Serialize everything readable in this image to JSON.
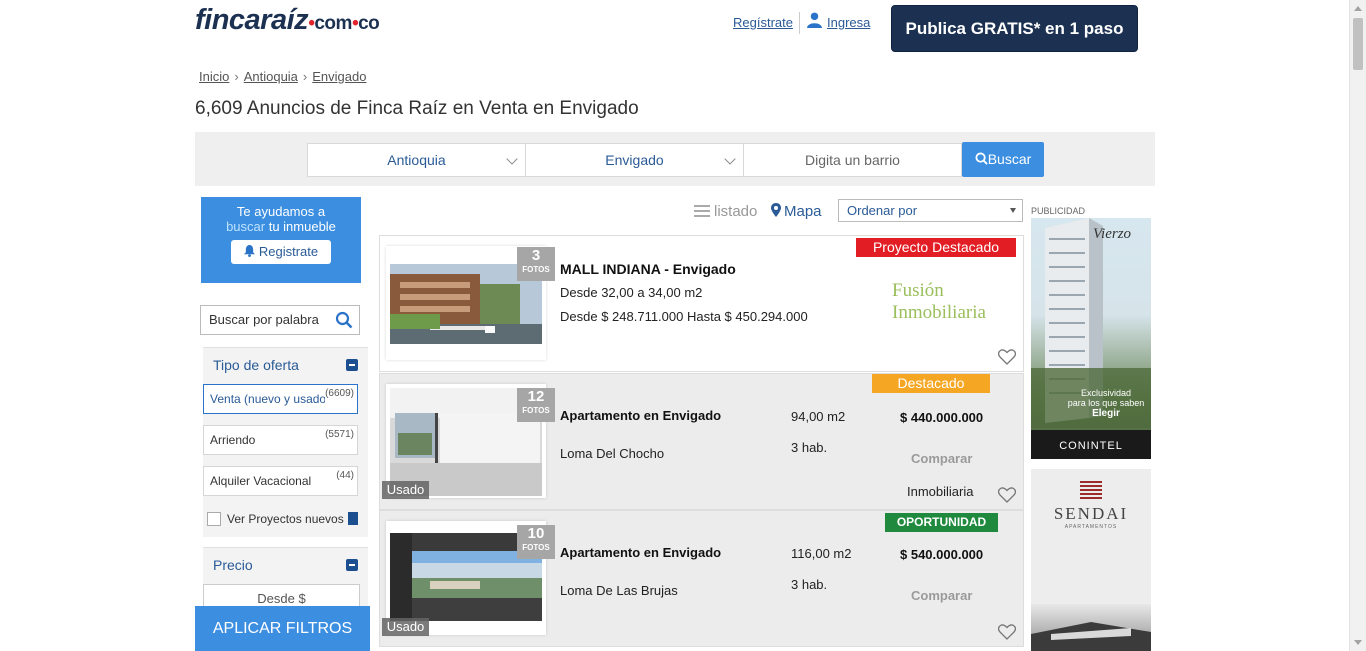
{
  "header": {
    "logo_main": "fincaraíz",
    "logo_com": "com",
    "logo_co": "co",
    "register_link": "Regístrate",
    "login_link": "Ingresa",
    "publish_button": "Publica GRATIS* en 1 paso"
  },
  "breadcrumb": [
    "Inicio",
    "Antioquia",
    "Envigado"
  ],
  "page_title": "6,609 Anuncios de Finca Raíz en Venta en Envigado",
  "search": {
    "department": "Antioquia",
    "city": "Envigado",
    "barrio_placeholder": "Digita un barrio",
    "button": "Buscar"
  },
  "sidebar": {
    "help_line1": "Te ayudamos a",
    "help_hl": "buscar",
    "help_rest": " tu inmueble",
    "help_button": "Registrate",
    "keyword_placeholder": "Buscar por palabra",
    "facet_offer": "Tipo de oferta",
    "options": [
      {
        "label": "Venta (nuevo y usado)",
        "count": "(6609)"
      },
      {
        "label": "Arriendo",
        "count": "(5571)"
      },
      {
        "label": "Alquiler Vacacional",
        "count": "(44)"
      }
    ],
    "projects": "Ver Proyectos nuevos",
    "facet_price": "Precio",
    "desde": "Desde $",
    "apply": "APLICAR FILTROS"
  },
  "toolbar": {
    "listado": "listado",
    "mapa": "Mapa",
    "order": "Ordenar por"
  },
  "listings": [
    {
      "ribbon": "Proyecto Destacado",
      "photos": "3",
      "fotos": "FOTOS",
      "title": "MALL INDIANA - Envigado",
      "line1": "Desde 32,00 a 34,00 m2",
      "line2": "Desde $ 248.711.000 Hasta $ 450.294.000",
      "agency_logo": "Fusión Inmobiliaria"
    },
    {
      "ribbon": "Destacado",
      "photos": "12",
      "fotos": "FOTOS",
      "condition": "Usado",
      "title": "Apartamento en Envigado",
      "neighborhood": "Loma Del Chocho",
      "area": "94,00 m2",
      "rooms": "3 hab.",
      "price": "$ 440.000.000",
      "compare": "Comparar",
      "agency": "Inmobiliaria"
    },
    {
      "ribbon": "OPORTUNIDAD",
      "photos": "10",
      "fotos": "FOTOS",
      "condition": "Usado",
      "title": "Apartamento en Envigado",
      "neighborhood": "Loma De Las Brujas",
      "area": "116,00 m2",
      "rooms": "3 hab.",
      "price": "$ 540.000.000",
      "compare": "Comparar"
    }
  ],
  "ads": {
    "label": "PUBLICIDAD",
    "ad1_brand": "Vierzo",
    "ad1_line1": "Exclusividad",
    "ad1_line2": "para los que saben",
    "ad1_cta": "Elegir",
    "ad1_company": "CONINTEL",
    "ad2_brand": "SENDAI",
    "ad2_sub": "APARTAMENTOS"
  },
  "colors": {
    "brand_navy": "#1c3151",
    "accent_blue": "#3b8ee0",
    "ribbon_red": "#e21d24",
    "ribbon_orange": "#f5a623",
    "ribbon_green": "#1f8a3e"
  }
}
